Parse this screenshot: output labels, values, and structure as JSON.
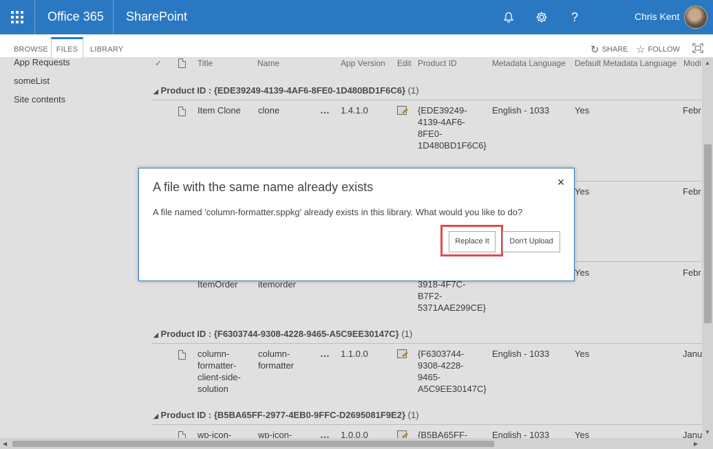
{
  "suitebar": {
    "app_launcher_icon": "waffle-icon",
    "brand": "Office 365",
    "site": "SharePoint",
    "notifications_icon": "bell-icon",
    "settings_icon": "gear-icon",
    "help_icon": "?",
    "user_name": "Chris Kent"
  },
  "ribbon": {
    "tabs": [
      "BROWSE",
      "FILES",
      "LIBRARY"
    ],
    "share_label": "SHARE",
    "follow_label": "FOLLOW"
  },
  "leftnav": {
    "items": [
      "App Requests",
      "someList",
      "Site contents"
    ]
  },
  "list": {
    "columns": [
      "Title",
      "Name",
      "App Version",
      "Edit",
      "Product ID",
      "Metadata Language",
      "Default Metadata Language",
      "Modi"
    ],
    "groups": [
      {
        "label": "Product ID : {EDE39249-4139-4AF6-8FE0-1D480BD1F6C6}",
        "count": "(1)"
      },
      {
        "label": "Product ID : {F6303744-9308-4228-9465-A5C9EE30147C}",
        "count": "(1)"
      },
      {
        "label": "Product ID : {B5BA65FF-2977-4EB0-9FFC-D2695081F9E2}",
        "count": "(1)"
      }
    ],
    "rows": [
      {
        "title": "Item Clone",
        "name": "clone",
        "version": "1.4.1.0",
        "product_id": [
          "{EDE39249-",
          "4139-4AF6-",
          "8FE0-",
          "1D480BD1F6C6}"
        ],
        "language": "English - 1033",
        "default_language": "Yes",
        "modified": "Febr"
      },
      {
        "default_language": "Yes",
        "modified": "Febr"
      },
      {
        "title": "ItemOrder",
        "name": "itemorder",
        "product_id": [
          "3918-4F7C-",
          "B7F2-",
          "5371AAE299CE}"
        ],
        "default_language": "Yes",
        "modified": "Febr"
      },
      {
        "title": [
          "column-",
          "formatter-",
          "client-side-",
          "solution"
        ],
        "name": [
          "column-",
          "formatter"
        ],
        "version": "1.1.0.0",
        "product_id": [
          "{F6303744-",
          "9308-4228-",
          "9465-",
          "A5C9EE30147C}"
        ],
        "language": "English - 1033",
        "default_language": "Yes",
        "modified": "Janu"
      },
      {
        "title": "wp-icon-",
        "name": "wp-icon-",
        "version": "1.0.0.0",
        "product_id": "{B5BA65FF-",
        "language": "English - 1033",
        "default_language": "Yes",
        "modified": "Janu"
      }
    ]
  },
  "dialog": {
    "title": "A file with the same name already exists",
    "message": "A file named 'column-formatter.sppkg' already exists in this library. What would you like to do?",
    "replace_label": "Replace It",
    "dont_upload_label": "Don't Upload",
    "close_icon": "×",
    "highlight_color": "#e8474b"
  },
  "colors": {
    "suitebar": "#2b78c2",
    "accent": "#2b78c2"
  }
}
